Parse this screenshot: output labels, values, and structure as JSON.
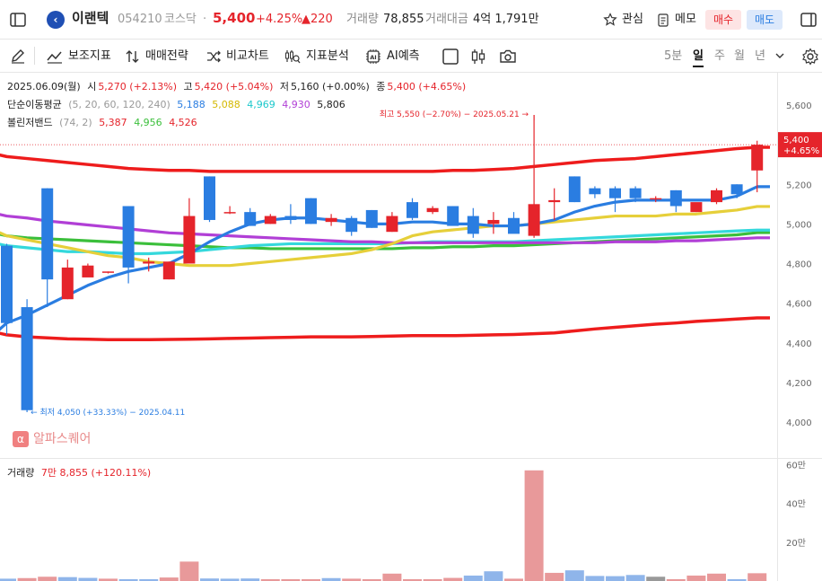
{
  "header": {
    "stock_name": "이랜텍",
    "stock_code": "054210",
    "market": "코스닥",
    "dot": "·",
    "price": "5,400",
    "change_pct": "+4.25%",
    "change_abs": "▲220",
    "volume_label": "거래량",
    "volume_value": "78,855",
    "amount_label": "거래대금",
    "amount_value": "4억 1,791만",
    "watch_label": "관심",
    "memo_label": "메모",
    "buy_label": "매수",
    "sell_label": "매도",
    "colors": {
      "up": "#e5242b",
      "down": "#2a7de1"
    }
  },
  "toolbar": {
    "indicators_label": "보조지표",
    "strategy_label": "매매전략",
    "compare_label": "비교차트",
    "pattern_label": "지표분석",
    "ai_label": "AI예측",
    "periods": [
      "5분",
      "일",
      "주",
      "월",
      "년"
    ],
    "active_period": "일"
  },
  "info": {
    "date": "2025.06.09(월)",
    "open_label": "시",
    "open_value": "5,270 (+2.13%)",
    "high_label": "고",
    "high_value": "5,420 (+5.04%)",
    "low_label": "저",
    "low_value": "5,160 (+0.00%)",
    "close_label": "종",
    "close_value": "5,400 (+4.65%)",
    "ma_label": "단순이동평균",
    "ma_params": "(5, 20, 60, 120, 240)",
    "ma_values": [
      "5,188",
      "5,088",
      "4,969",
      "4,930",
      "5,806"
    ],
    "bb_label": "볼린저밴드",
    "bb_params": "(74, 2)",
    "bb_values": [
      "5,387",
      "4,956",
      "4,526"
    ]
  },
  "annotations": {
    "high_text": "최고 5,550 (−2.70%) − 2025.05.21",
    "low_text": "최저 4,050 (+33.33%) − 2025.04.11",
    "price_tag": "5,400",
    "price_tag_pct": "+4.65%"
  },
  "watermark": "알파스퀘어",
  "volume_panel": {
    "label": "거래량",
    "value": "7만 8,855 (+120.11%)"
  },
  "chart_data": [
    {
      "type": "candlestick",
      "ylim": [
        3900,
        5650
      ],
      "y_ticks": [
        "4,000",
        "4,200",
        "4,400",
        "4,600",
        "4,800",
        "5,000",
        "5,200",
        "5,400",
        "5,600"
      ],
      "ohlc": [
        [
          4890,
          4900,
          4440,
          4500
        ],
        [
          4580,
          4620,
          4050,
          4060
        ],
        [
          5180,
          5180,
          4580,
          4720
        ],
        [
          4620,
          4820,
          4620,
          4780
        ],
        [
          4730,
          4800,
          4740,
          4790
        ],
        [
          4760,
          4760,
          4750,
          4760
        ],
        [
          5090,
          5090,
          4700,
          4780
        ],
        [
          4800,
          4830,
          4760,
          4810
        ],
        [
          4720,
          4810,
          4720,
          4810
        ],
        [
          4800,
          5130,
          4800,
          5040
        ],
        [
          5240,
          5240,
          5010,
          5020
        ],
        [
          5060,
          5090,
          5050,
          5060
        ],
        [
          5060,
          5080,
          4990,
          4990
        ],
        [
          5000,
          5050,
          5000,
          5040
        ],
        [
          5040,
          5100,
          5000,
          5020
        ],
        [
          5130,
          5130,
          5000,
          5000
        ],
        [
          5010,
          5050,
          4990,
          5030
        ],
        [
          5030,
          5040,
          4940,
          4960
        ],
        [
          5070,
          5070,
          4980,
          4980
        ],
        [
          4960,
          5060,
          4960,
          5040
        ],
        [
          5110,
          5130,
          5020,
          5030
        ],
        [
          5060,
          5090,
          5050,
          5080
        ],
        [
          5090,
          5090,
          5010,
          4990
        ],
        [
          5040,
          5080,
          4930,
          4950
        ],
        [
          5000,
          5060,
          4950,
          5020
        ],
        [
          5030,
          5060,
          4960,
          4950
        ],
        [
          4940,
          5550,
          4930,
          5100
        ],
        [
          5110,
          5180,
          5020,
          5120
        ],
        [
          5240,
          5240,
          5110,
          5110
        ],
        [
          5180,
          5190,
          5130,
          5150
        ],
        [
          5180,
          5190,
          5060,
          5130
        ],
        [
          5180,
          5190,
          5110,
          5130
        ],
        [
          5130,
          5140,
          5110,
          5130
        ],
        [
          5170,
          5170,
          5060,
          5090
        ],
        [
          5060,
          5070,
          5060,
          5110
        ],
        [
          5110,
          5180,
          5100,
          5170
        ],
        [
          5200,
          5200,
          5130,
          5150
        ],
        [
          5270,
          5420,
          5160,
          5400
        ]
      ],
      "moving_averages": [
        {
          "name": "MA5",
          "color": "#2a7de1",
          "y": [
            4500,
            4540,
            4590,
            4640,
            4690,
            4730,
            4760,
            4780,
            4800,
            4850,
            4910,
            4960,
            5000,
            5020,
            5030,
            5030,
            5020,
            5010,
            5000,
            5000,
            5010,
            5010,
            5000,
            5000,
            4990,
            4990,
            5000,
            5020,
            5060,
            5090,
            5110,
            5120,
            5120,
            5120,
            5120,
            5120,
            5140,
            5188
          ]
        },
        {
          "name": "MA20",
          "color": "#e6cf3a",
          "y": [
            4940,
            4920,
            4900,
            4880,
            4860,
            4840,
            4830,
            4810,
            4800,
            4790,
            4790,
            4790,
            4800,
            4810,
            4820,
            4830,
            4840,
            4850,
            4870,
            4900,
            4940,
            4960,
            4970,
            4980,
            4990,
            4990,
            5000,
            5010,
            5020,
            5030,
            5040,
            5040,
            5040,
            5050,
            5050,
            5060,
            5070,
            5088
          ]
        },
        {
          "name": "MA60",
          "color": "#34d8dc",
          "y": [
            4890,
            4880,
            4870,
            4860,
            4860,
            4855,
            4850,
            4850,
            4855,
            4860,
            4870,
            4880,
            4890,
            4895,
            4900,
            4900,
            4900,
            4900,
            4900,
            4900,
            4905,
            4910,
            4910,
            4910,
            4910,
            4910,
            4915,
            4920,
            4925,
            4930,
            4935,
            4940,
            4945,
            4950,
            4955,
            4960,
            4965,
            4969
          ]
        },
        {
          "name": "MA120",
          "color": "#b13fd6",
          "y": [
            5040,
            5030,
            5015,
            5005,
            4995,
            4985,
            4975,
            4965,
            4955,
            4950,
            4945,
            4940,
            4935,
            4930,
            4925,
            4920,
            4915,
            4910,
            4910,
            4905,
            4905,
            4905,
            4905,
            4905,
            4905,
            4905,
            4905,
            4905,
            4905,
            4905,
            4910,
            4910,
            4910,
            4915,
            4915,
            4920,
            4925,
            4930
          ]
        },
        {
          "name": "MA240",
          "color": "#3bbf3b",
          "y": [
            4940,
            4930,
            4925,
            4920,
            4915,
            4910,
            4905,
            4900,
            4895,
            4890,
            4885,
            4880,
            4880,
            4875,
            4875,
            4875,
            4875,
            4875,
            4875,
            4875,
            4880,
            4880,
            4885,
            4885,
            4890,
            4890,
            4895,
            4900,
            4905,
            4910,
            4915,
            4920,
            4925,
            4930,
            4935,
            4940,
            4945,
            4956
          ]
        }
      ],
      "bollinger": {
        "color": "#ee1c1c",
        "upper": [
          5340,
          5330,
          5320,
          5310,
          5300,
          5290,
          5280,
          5275,
          5270,
          5270,
          5265,
          5265,
          5265,
          5265,
          5265,
          5265,
          5265,
          5265,
          5265,
          5265,
          5265,
          5265,
          5270,
          5270,
          5275,
          5280,
          5290,
          5300,
          5310,
          5320,
          5325,
          5330,
          5340,
          5350,
          5360,
          5370,
          5380,
          5387
        ],
        "lower": [
          4440,
          4430,
          4425,
          4420,
          4418,
          4416,
          4416,
          4416,
          4417,
          4418,
          4420,
          4422,
          4424,
          4426,
          4428,
          4430,
          4430,
          4430,
          4432,
          4434,
          4436,
          4436,
          4436,
          4438,
          4440,
          4442,
          4446,
          4450,
          4460,
          4470,
          4478,
          4486,
          4494,
          4500,
          4508,
          4514,
          4520,
          4526
        ]
      }
    },
    {
      "type": "bar",
      "title": "거래량",
      "ylim": [
        0,
        62000
      ],
      "y_ticks": [
        "20만",
        "40만",
        "60만"
      ],
      "up_color": "#e8999a",
      "down_color": "#8fb5ea",
      "flat_color": "#999999",
      "values": [
        1200,
        1500,
        2200,
        2000,
        1600,
        1200,
        500,
        200,
        1800,
        10000,
        1300,
        1200,
        1300,
        300,
        300,
        300,
        1500,
        1200,
        800,
        3800,
        300,
        300,
        1600,
        2800,
        5000,
        1200,
        57000,
        4200,
        5500,
        2600,
        2500,
        3100,
        2200,
        300,
        2800,
        3800,
        300,
        4000
      ],
      "directions": [
        "down",
        "up",
        "up",
        "down",
        "down",
        "up",
        "down",
        "down",
        "up",
        "up",
        "down",
        "down",
        "down",
        "up",
        "up",
        "up",
        "down",
        "up",
        "up",
        "up",
        "up",
        "up",
        "up",
        "down",
        "down",
        "up",
        "up",
        "up",
        "down",
        "down",
        "down",
        "down",
        "flat",
        "up",
        "up",
        "up",
        "down",
        "up"
      ]
    }
  ]
}
